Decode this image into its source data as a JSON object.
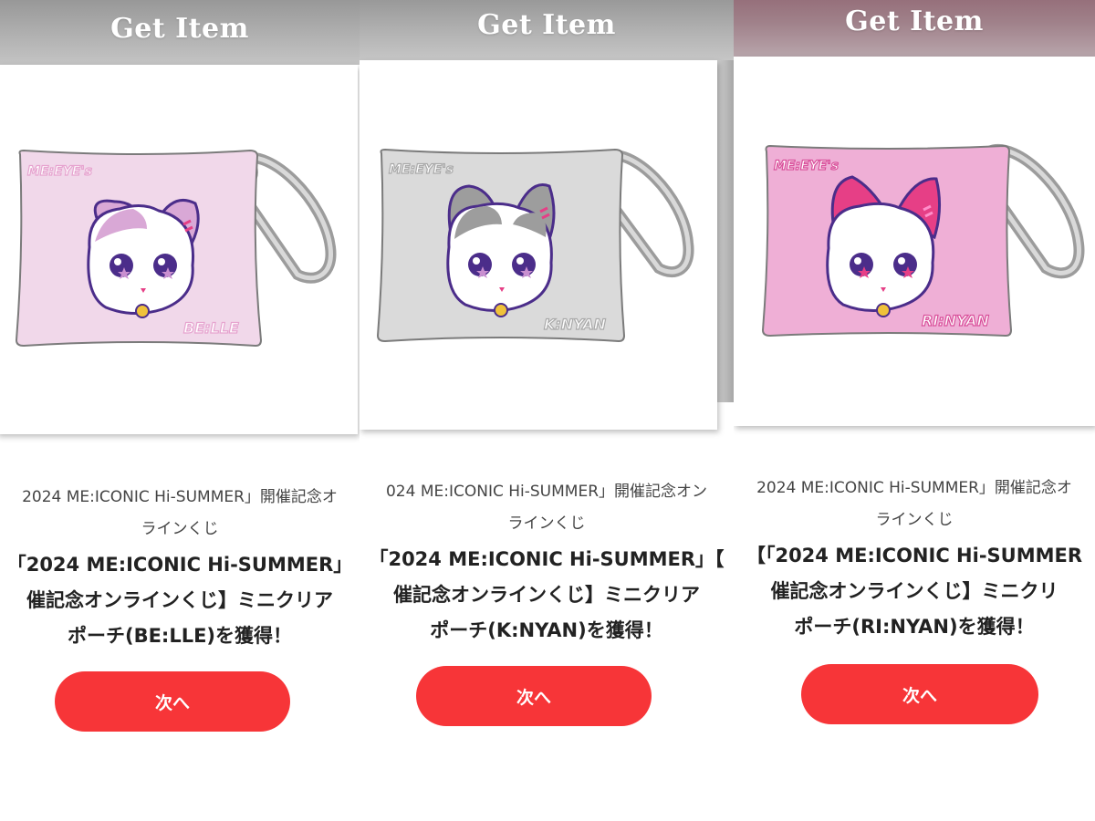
{
  "colors": {
    "button_red": "#f73538",
    "header_gray": "#a6a6a6",
    "header_mauve": "#a0818a",
    "pouch_belle": "#f1d8ea",
    "pouch_knyan": "#dadada",
    "pouch_rinyan": "#efafd6"
  },
  "panels": [
    {
      "header_title": "Get Item",
      "pouch_logo": "ME:EYE's",
      "pouch_name": "BE:LLE",
      "line1": "2024 ME:ICONIC Hi-SUMMER」開催記念オ",
      "line2": "ラインくじ",
      "title_lines": [
        "「2024 ME:ICONIC Hi-SUMMER」",
        "催記念オンラインくじ】ミニクリア",
        "ポーチ(BE:LLE)を獲得！"
      ],
      "button_label": "次へ"
    },
    {
      "header_title": "Get Item",
      "pouch_logo": "ME:EYE's",
      "pouch_name": "K:NYAN",
      "line1": "024 ME:ICONIC Hi-SUMMER」開催記念オン",
      "line2": "ラインくじ",
      "title_lines": [
        "「2024 ME:ICONIC Hi-SUMMER」【",
        "催記念オンラインくじ】ミニクリア",
        "ポーチ(K:NYAN)を獲得！"
      ],
      "button_label": "次へ"
    },
    {
      "header_title": "Get Item",
      "pouch_logo": "ME:EYE's",
      "pouch_name": "RI:NYAN",
      "line1": "2024 ME:ICONIC Hi-SUMMER」開催記念オ",
      "line2": "ラインくじ",
      "title_lines": [
        "【「2024 ME:ICONIC Hi-SUMMER",
        "催記念オンラインくじ】ミニクリ",
        "ポーチ(RI:NYAN)を獲得！"
      ],
      "button_label": "次へ"
    }
  ]
}
